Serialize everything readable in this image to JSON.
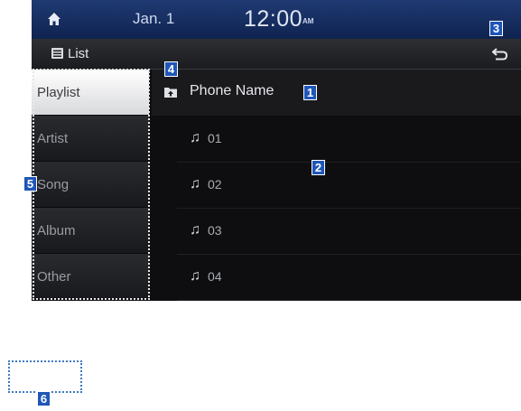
{
  "status_bar": {
    "date": "Jan. 1",
    "time": "12:00",
    "ampm": "AM"
  },
  "title_bar": {
    "label": "List"
  },
  "sidebar": {
    "items": [
      {
        "label": "Playlist",
        "active": true
      },
      {
        "label": "Artist",
        "active": false
      },
      {
        "label": "Song",
        "active": false
      },
      {
        "label": "Album",
        "active": false
      },
      {
        "label": "Other",
        "active": false
      }
    ]
  },
  "content": {
    "folder": "Phone Name",
    "tracks": [
      "01",
      "02",
      "03",
      "04"
    ]
  },
  "callouts": [
    "1",
    "2",
    "3",
    "4",
    "5",
    "6"
  ],
  "colors": {
    "accent": "#1f56b8",
    "status_bar": "#1f3a72",
    "dotted_box": "#3d79c7"
  }
}
